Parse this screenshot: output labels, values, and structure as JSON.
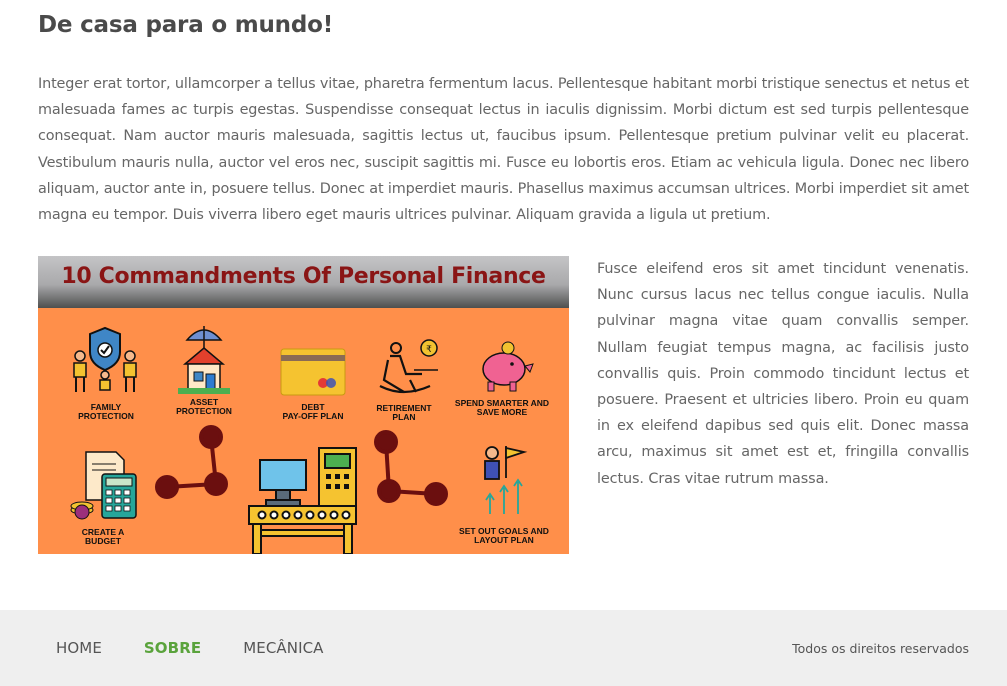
{
  "page": {
    "title": "De casa para o mundo!",
    "intro": "Integer erat tortor, ullamcorper a tellus vitae, pharetra fermentum lacus. Pellentesque habitant morbi tristique senectus et netus et malesuada fames ac turpis egestas. Suspendisse consequat lectus in iaculis dignissim. Morbi dictum est sed turpis pellentesque consequat. Nam auctor mauris malesuada, sagittis lectus ut, faucibus ipsum. Pellentesque pretium pulvinar velit eu placerat. Vestibulum mauris nulla, auctor vel eros nec, suscipit sagittis mi. Fusce eu lobortis eros. Etiam ac vehicula ligula. Donec nec libero aliquam, auctor ante in, posuere tellus. Donec at imperdiet mauris. Phasellus maximus accumsan ultrices. Morbi imperdiet sit amet magna eu tempor. Duis viverra libero eget mauris ultrices pulvinar. Aliquam gravida a ligula ut pretium.",
    "side_text": "Fusce eleifend eros sit amet tincidunt venenatis. Nunc cursus lacus nec tellus congue iaculis. Nulla pulvinar magna vitae quam convallis semper. Nullam feugiat tempus magna, ac facilisis justo convallis quis. Proin commodo tincidunt lectus et posuere. Praesent et ultricies libero. Proin eu quam in ex eleifend dapibus sed quis elit. Donec massa arcu, maximus sit amet est et, fringilla convallis lectus. Cras vitae rutrum massa."
  },
  "infographic": {
    "title": "10 Commandments Of Personal Finance",
    "labels": {
      "family": "FAMILY\nPROTECTION",
      "asset": "ASSET\nPROTECTION",
      "debt": "DEBT\nPAY-OFF PLAN",
      "retirement": "RETIREMENT\nPLAN",
      "spend": "SPEND SMARTER AND\nSAVE MORE",
      "budget": "CREATE A\nBUDGET",
      "goals": "SET OUT GOALS AND\nLAYOUT PLAN"
    },
    "colors": {
      "background": "#ff8f4a",
      "title": "#8a1515",
      "connector": "#6b0f0f"
    },
    "icons": [
      "family-protection-icon",
      "asset-protection-icon",
      "debt-card-icon",
      "retirement-rocking-chair-icon",
      "piggy-bank-icon",
      "budget-calculator-icon",
      "machine-icon",
      "goals-flag-icon"
    ]
  },
  "footer": {
    "nav": [
      "HOME",
      "SOBRE",
      "MECÂNICA"
    ],
    "active": "SOBRE",
    "rights": "Todos os direitos reservados"
  },
  "colors": {
    "accent": "#5aa33c",
    "footer_bg": "#efefef"
  }
}
